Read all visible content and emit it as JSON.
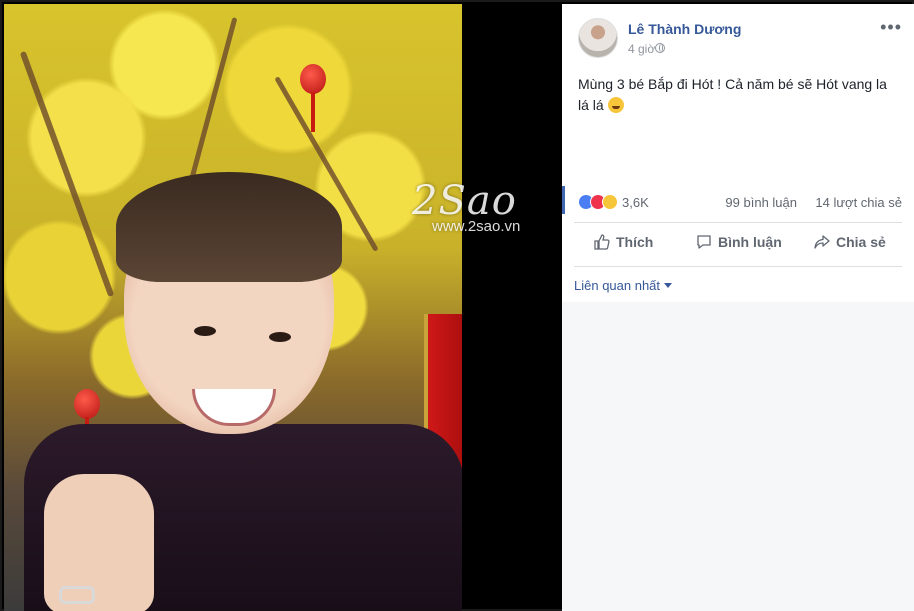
{
  "watermark": {
    "logo": "2Sao",
    "url": "www.2sao.vn"
  },
  "post": {
    "author": "Lê Thành Dương",
    "time": "4 giờ",
    "privacy_icon": "globe-icon",
    "more_icon": "ellipsis-icon",
    "text": "Mùng 3 bé Bắp đi Hót ! Cả năm bé sẽ Hót vang la lá lá"
  },
  "reactions": {
    "icons": [
      "like-reaction-icon",
      "love-reaction-icon",
      "haha-reaction-icon"
    ],
    "count": "3,6K",
    "comments": "99 bình luận",
    "shares": "14 lượt chia sẻ"
  },
  "actions": {
    "like": "Thích",
    "comment": "Bình luận",
    "share": "Chia sẻ"
  },
  "sort": {
    "label": "Liên quan nhất"
  },
  "colors": {
    "link": "#365899",
    "accent": "#4267b2",
    "text": "#1d2129",
    "muted": "#606770"
  }
}
